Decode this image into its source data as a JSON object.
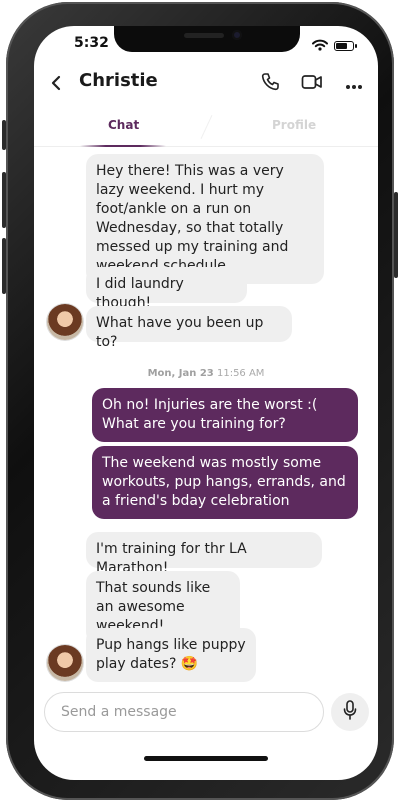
{
  "status_bar": {
    "time": "5:32",
    "battery_level": 0.7
  },
  "header": {
    "title": "Christie",
    "back_icon": "chevron-left-icon",
    "actions": [
      {
        "name": "phone-call-button",
        "icon": "phone-icon"
      },
      {
        "name": "video-call-button",
        "icon": "video-camera-icon"
      },
      {
        "name": "more-options-button",
        "icon": "ellipsis-icon"
      }
    ]
  },
  "tabs": [
    {
      "label": "Chat",
      "active": true
    },
    {
      "label": "Profile",
      "active": false
    }
  ],
  "colors": {
    "accent": "#5d2a5e",
    "incoming_bubble": "#efefef",
    "outgoing_text": "#ffffff"
  },
  "messages": {
    "group1": [
      {
        "direction": "in",
        "text": "Hey there! This was a very lazy weekend. I hurt my foot/ankle on a run on Wednesday, so that totally messed up my training and weekend schedule."
      },
      {
        "direction": "in",
        "text": "I did laundry though!"
      },
      {
        "direction": "in",
        "text": "What have you been up to?"
      }
    ],
    "timestamp": {
      "date": "Mon, Jan 23",
      "time": "11:56 AM"
    },
    "group2": [
      {
        "direction": "out",
        "text": "Oh no! Injuries are the worst :( What are you training for?"
      },
      {
        "direction": "out",
        "text": "The weekend was mostly some workouts, pup hangs, errands, and a friend's bday celebration"
      }
    ],
    "group3": [
      {
        "direction": "in",
        "text": "I'm training for thr LA Marathon!"
      },
      {
        "direction": "in",
        "text": "That sounds like an awesome weekend!"
      },
      {
        "direction": "in",
        "text": "Pup hangs like puppy play dates?",
        "emoji": "🤩"
      }
    ]
  },
  "composer": {
    "placeholder": "Send a message",
    "value": ""
  }
}
